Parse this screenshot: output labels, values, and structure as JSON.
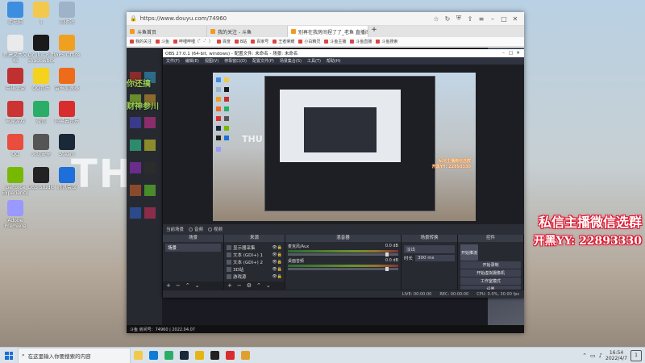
{
  "desktop": {
    "icons": [
      {
        "label": "此电脑",
        "color": "#3e8ee0"
      },
      {
        "label": "1",
        "color": "#f2c94c"
      },
      {
        "label": "回收站",
        "color": "#9fb3c8"
      },
      {
        "label": "新建文本文档",
        "color": "#eaeaea"
      },
      {
        "label": "Oculus Rift Shadowbox",
        "color": "#1a1a1a"
      },
      {
        "label": "WPS Office",
        "color": "#f0a020"
      },
      {
        "label": "英雄联盟",
        "color": "#c03030"
      },
      {
        "label": "QQ音乐",
        "color": "#f5d21b"
      },
      {
        "label": "雷神加速器",
        "color": "#ee6b1a"
      },
      {
        "label": "电竞游戏",
        "color": "#c33"
      },
      {
        "label": "微信",
        "color": "#2aae67"
      },
      {
        "label": "网易云音乐",
        "color": "#d92d2d"
      },
      {
        "label": "QQ",
        "color": "#e84d3d"
      },
      {
        "label": "火绒安全",
        "color": "#555"
      },
      {
        "label": "Steam",
        "color": "#1b2838"
      },
      {
        "label": "GeForce Experience",
        "color": "#76b900"
      },
      {
        "label": "OBS Studio",
        "color": "#222"
      },
      {
        "label": "腾讯会议",
        "color": "#1e6fd9"
      },
      {
        "label": "Adobe Premiere",
        "color": "#9999ff"
      }
    ],
    "bg_text": "THU",
    "promo_line1": "私信主播微信选群",
    "promo_line2": "开黑YY: 22893330"
  },
  "browser": {
    "url": "https://www.douyu.com/74960",
    "tabs": [
      {
        "label": "斗鱼首页"
      },
      {
        "label": "我的关注 - 斗鱼"
      },
      {
        "label": "别再在我房间捏了了_老鱼 直播间"
      }
    ],
    "new_tab": "+",
    "bookmarks": [
      "我的关注",
      "斗鱼",
      "哔哩哔哩（゜-゜）",
      "百度",
      "B站",
      "百家号",
      "王者荣耀",
      "小白精灵",
      "斗鱼主播",
      "斗鱼直播",
      "斗鱼搜索"
    ],
    "left_overlay_1": "你还搞",
    "left_overlay_2": "财神参川",
    "footer": "斗鱼 房间号：74960 | 2022.04.07"
  },
  "obs": {
    "title": "OBS 27.0.1 (64-bit, windows) - 配置文件: 未命名 - 场景: 未命名",
    "menu": [
      "文件(F)",
      "编辑(E)",
      "视图(V)",
      "停靠窗口(D)",
      "配置文件(P)",
      "场景集合(S)",
      "工具(T)",
      "帮助(H)"
    ],
    "scene_label": "当前场景",
    "preview_promo_1": "私信主播微信选群",
    "preview_promo_2": "开黑YY: 22893330",
    "status_options": [
      "音频",
      "视频"
    ],
    "docks": {
      "scenes": {
        "header": "场景",
        "items": [
          "场景"
        ]
      },
      "sources": {
        "header": "来源",
        "items": [
          "显示器采集",
          "文本 (GDI+) 1",
          "文本 (GDI+) 2",
          "3D站",
          "游戏源",
          "窗口采集"
        ]
      },
      "mixer": {
        "header": "混音器",
        "channels": [
          {
            "name": "麦克风/Aux",
            "db": "0.0 dB"
          },
          {
            "name": "桌面音频",
            "db": "0.0 dB"
          }
        ]
      },
      "transitions": {
        "header": "场景转换",
        "selected": "淡出",
        "duration_label": "时长",
        "duration_value": "300 ms"
      },
      "controls": {
        "header": "控件",
        "buttons": [
          "开始推流",
          "开始录制",
          "开始虚拟摄像机",
          "工作室模式",
          "设置",
          "退出"
        ]
      }
    },
    "footer": {
      "live": "LIVE: 00:00:00",
      "rec": "REC: 00:00:00",
      "cpu": "CPU: 0.0%, 30.00 fps"
    }
  },
  "taskbar": {
    "search_placeholder": "在这里输入你要搜索的内容",
    "apps": [
      "文件资源管理器",
      "Edge",
      "微信",
      "Steam",
      "收藏",
      "OBS",
      "网易云",
      "新建"
    ],
    "time": "16:54",
    "date": "2022/4/7",
    "notify": "1"
  }
}
